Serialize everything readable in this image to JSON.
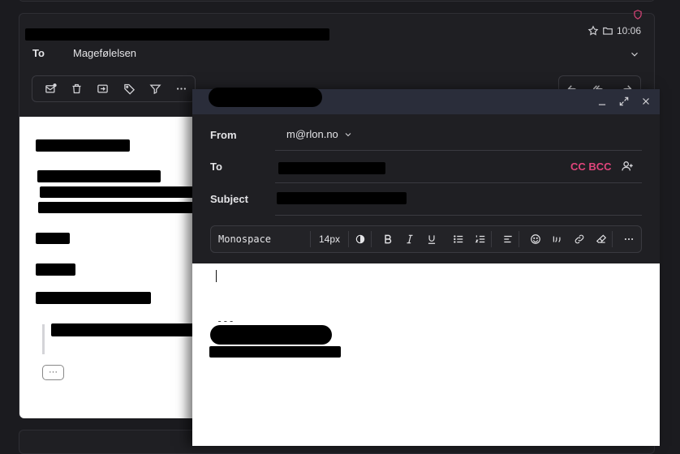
{
  "message": {
    "to_label": "To",
    "to_value": "Magefølelsen",
    "time": "10:06",
    "icons": [
      "shield-icon",
      "star-icon",
      "folder-icon",
      "chevron-down-icon"
    ],
    "toolbar_icons": [
      "mark-read-icon",
      "trash-icon",
      "move-icon",
      "tag-icon",
      "filter-icon",
      "more-icon"
    ],
    "reply_icons": [
      "reply-icon",
      "reply-all-icon",
      "forward-icon"
    ],
    "expand_label": "···"
  },
  "compose": {
    "from_label": "From",
    "from_value": "m@rlon.no",
    "to_label": "To",
    "cc_bcc_label": "CC BCC",
    "subject_label": "Subject",
    "font_family": "Monospace",
    "font_size": "14px",
    "signature_separator": "---",
    "window_icons": [
      "minimize-icon",
      "expand-icon",
      "close-icon"
    ],
    "format_icons": [
      "contrast-icon",
      "bold-icon",
      "italic-icon",
      "underline-icon",
      "bullet-list-icon",
      "numbered-list-icon",
      "align-left-icon",
      "emoji-icon",
      "quote-icon",
      "link-icon",
      "eraser-icon",
      "more-icon"
    ]
  },
  "colors": {
    "accent": "#e0457b",
    "background": "#1b1b1f",
    "panel": "#1f1f23",
    "header": "#2a2d3a"
  }
}
